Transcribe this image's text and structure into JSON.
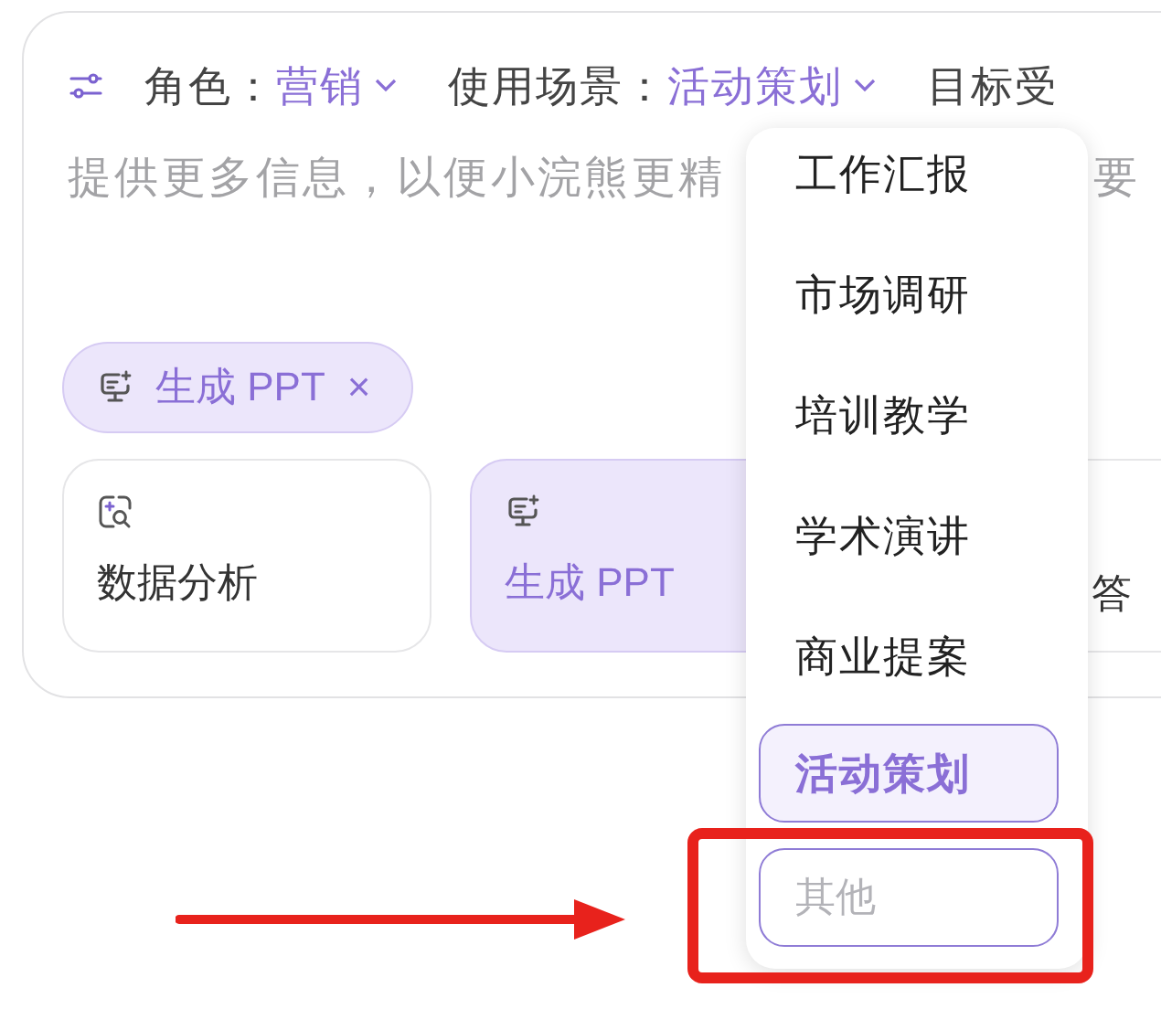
{
  "toolbar": {
    "fields": [
      {
        "label": "角色：",
        "value": "营销"
      },
      {
        "label": "使用场景：",
        "value": "活动策划"
      },
      {
        "label": "目标受"
      }
    ]
  },
  "prompt_hint": [
    "提供更多信息，以便小浣熊更精",
    "要"
  ],
  "selected_tag": {
    "label": "生成 PPT",
    "close": "×"
  },
  "skills": [
    {
      "label": "数据分析",
      "selected": false,
      "kind": "analysis"
    },
    {
      "label": "生成 PPT",
      "selected": true,
      "kind": "ppt"
    },
    {
      "label": "答",
      "selected": false,
      "kind": "partial"
    }
  ],
  "dropdown": {
    "options": [
      {
        "label": "工作汇报",
        "selected": false
      },
      {
        "label": "市场调研",
        "selected": false
      },
      {
        "label": "培训教学",
        "selected": false
      },
      {
        "label": "学术演讲",
        "selected": false
      },
      {
        "label": "商业提案",
        "selected": false
      },
      {
        "label": "活动策划",
        "selected": true
      }
    ],
    "other_input": {
      "placeholder": "其他"
    }
  }
}
